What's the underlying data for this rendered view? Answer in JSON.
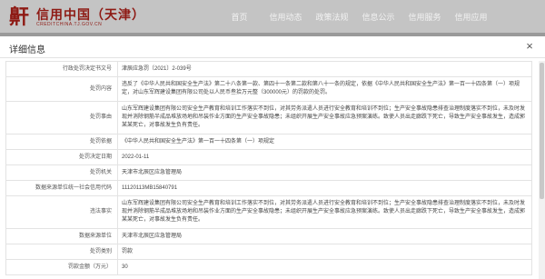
{
  "header": {
    "logo_char": "鼾",
    "title": "信用中国（天津）",
    "subtitle": "CREDITCHINA.TJ.GOV.CN",
    "nav": [
      "首页",
      "信用动态",
      "政策法规",
      "信息公示",
      "信用服务",
      "信用应用"
    ]
  },
  "modal": {
    "title": "详细信息",
    "close": "×",
    "rows": [
      {
        "label": "行政处罚决定书文号",
        "value": "津辰应急罚〔2021〕2-039号"
      },
      {
        "label": "处罚内容",
        "value": "违反了《中华人民共和国安全生产法》第二十八条第一款、第四十一条第二款和第八十一条的规定，依据《中华人民共和国安全生产法》第一百一十四条第（一）项规定，对山东军辉建设集团有限公司处以人民币叁拾万元整（300000元）的罚款的处罚。"
      },
      {
        "label": "处罚事由",
        "value": "山东军辉建设集团有限公司安全生产教育和培训工作落实不到位，对其劳务派遣人员进行安全教育和培训不到位；生产安全事故隐患排查治理制度落实不到位，未及时发现并消除钢筋半成品堆放场地和吊装作业方面的生产安全事故隐患；未组织开展生产安全事故应急预案演练。致使人员出走廊跌下死亡，导致生产安全事故发生，造成郭某某死亡，对事故发生负有责任。"
      },
      {
        "label": "处罚依据",
        "value": "《中华人民共和国安全生产法》第一百一十四条第（一）项规定"
      },
      {
        "label": "处罚决定日期",
        "value": "2022-01-11"
      },
      {
        "label": "处罚机关",
        "value": "天津市北辰区应急管理局"
      },
      {
        "label": "数据来源单位统一社会信用代码",
        "value": "11120113MB15840791"
      },
      {
        "label": "违法事实",
        "value": "山东军辉建设集团有限公司安全生产教育和培训工作落实不到位，对其劳务派遣人员进行安全教育和培训不到位；生产安全事故隐患排查治理制度落实不到位，未及时发现并消除钢筋半成品堆放场地和吊装作业方面的生产安全事故隐患；未组织开展生产安全事故应急预案演练。致使人员出走廊跌下死亡，导致生产安全事故发生，造成郭某某死亡，对事故发生负有责任。"
      },
      {
        "label": "数据来源单位",
        "value": "天津市北辰区应急管理局"
      },
      {
        "label": "处罚类别",
        "value": "罚款"
      },
      {
        "label": "罚款金额（万元）",
        "value": "30"
      }
    ]
  }
}
